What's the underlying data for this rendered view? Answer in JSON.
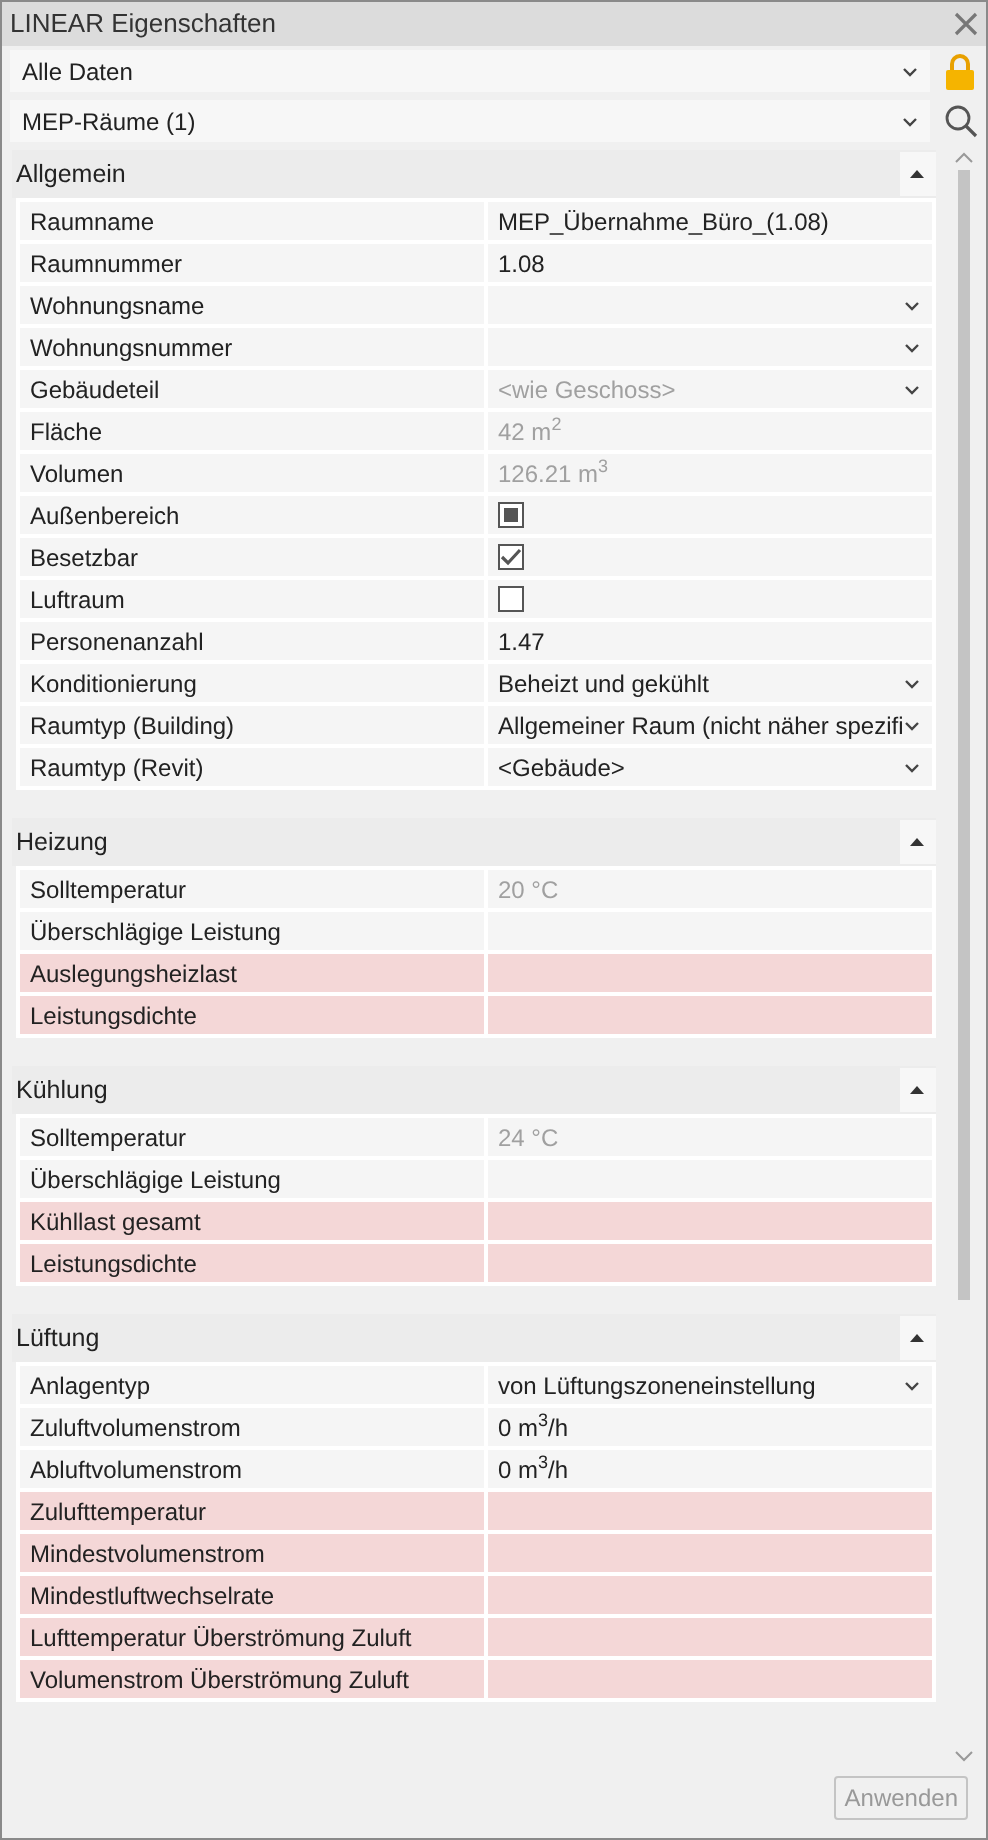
{
  "window": {
    "title": "LINEAR Eigenschaften"
  },
  "filters": [
    {
      "value": "Alle Daten",
      "kind": "lock"
    },
    {
      "value": "MEP-Räume (1)",
      "kind": "search"
    }
  ],
  "sections": [
    {
      "title": "Allgemein",
      "expanded": true,
      "rows": [
        {
          "label": "Raumname",
          "kind": "text",
          "value": "MEP_Übernahme_Büro_(1.08)",
          "readonly": false,
          "required": false
        },
        {
          "label": "Raumnummer",
          "kind": "text",
          "value": "1.08",
          "readonly": false,
          "required": false
        },
        {
          "label": "Wohnungsname",
          "kind": "dropdown",
          "readonly": false,
          "required": false
        },
        {
          "label": "Wohnungsnummer",
          "kind": "dropdown",
          "readonly": false,
          "required": false
        },
        {
          "label": "Gebäudeteil",
          "kind": "dropdown",
          "value": "<wie Geschoss>",
          "readonly": true,
          "required": false
        },
        {
          "label": "Fläche",
          "kind": "text",
          "value": "42 m$^{2}$",
          "readonly": true,
          "required": false
        },
        {
          "label": "Volumen",
          "kind": "text",
          "value": "126.21 m$^{3}$",
          "readonly": true,
          "required": false
        },
        {
          "label": "Außenbereich",
          "kind": "checkbox",
          "checked": false,
          "mixed": true,
          "readonly": false,
          "required": false
        },
        {
          "label": "Besetzbar",
          "kind": "checkbox",
          "checked": true,
          "mixed": false,
          "readonly": false,
          "required": false
        },
        {
          "label": "Luftraum",
          "kind": "checkbox",
          "checked": false,
          "mixed": false,
          "readonly": false,
          "required": false
        },
        {
          "label": "Personenanzahl",
          "kind": "text",
          "value": "1.47",
          "readonly": false,
          "required": false
        },
        {
          "label": "Konditionierung",
          "kind": "dropdown",
          "value": "Beheizt und gekühlt",
          "readonly": false,
          "required": false
        },
        {
          "label": "Raumtyp (Building)",
          "kind": "dropdown",
          "value": "Allgemeiner Raum (nicht näher spezifi",
          "readonly": false,
          "required": false
        },
        {
          "label": "Raumtyp (Revit)",
          "kind": "dropdown",
          "value": "<Gebäude>",
          "readonly": false,
          "required": false
        }
      ]
    },
    {
      "title": "Heizung",
      "expanded": true,
      "rows": [
        {
          "label": "Solltemperatur",
          "kind": "text",
          "value": "20 °C",
          "readonly": true,
          "required": false
        },
        {
          "label": "Überschlägige Leistung",
          "kind": "text",
          "readonly": false,
          "required": false
        },
        {
          "label": "Auslegungsheizlast",
          "kind": "text",
          "readonly": false,
          "required": true
        },
        {
          "label": "Leistungsdichte",
          "kind": "text",
          "readonly": false,
          "required": true
        }
      ]
    },
    {
      "title": "Kühlung",
      "expanded": true,
      "rows": [
        {
          "label": "Solltemperatur",
          "kind": "text",
          "value": "24 °C",
          "readonly": true,
          "required": false
        },
        {
          "label": "Überschlägige Leistung",
          "kind": "text",
          "readonly": false,
          "required": false
        },
        {
          "label": "Kühllast gesamt",
          "kind": "text",
          "readonly": false,
          "required": true
        },
        {
          "label": "Leistungsdichte",
          "kind": "text",
          "readonly": false,
          "required": true
        }
      ]
    },
    {
      "title": "Lüftung",
      "expanded": true,
      "rows": [
        {
          "label": "Anlagentyp",
          "kind": "dropdown",
          "value": "von Lüftungszoneneinstellung",
          "readonly": false,
          "required": false
        },
        {
          "label": "Zuluftvolumenstrom",
          "kind": "text",
          "value": "0 m$^{3}$/h",
          "readonly": false,
          "required": false
        },
        {
          "label": "Abluftvolumenstrom",
          "kind": "text",
          "value": "0 m$^{3}$/h",
          "readonly": false,
          "required": false
        },
        {
          "label": "Zulufttemperatur",
          "kind": "text",
          "readonly": false,
          "required": true
        },
        {
          "label": "Mindestvolumenstrom",
          "kind": "text",
          "readonly": false,
          "required": true
        },
        {
          "label": "Mindestluftwechselrate",
          "kind": "text",
          "readonly": false,
          "required": true
        },
        {
          "label": "Lufttemperatur Überströmung Zuluft",
          "kind": "text",
          "readonly": false,
          "required": true
        },
        {
          "label": "Volumenstrom Überströmung Zuluft",
          "kind": "text",
          "readonly": false,
          "required": true
        }
      ]
    }
  ],
  "apply_button": {
    "label": "Anwenden",
    "disabled": true
  }
}
